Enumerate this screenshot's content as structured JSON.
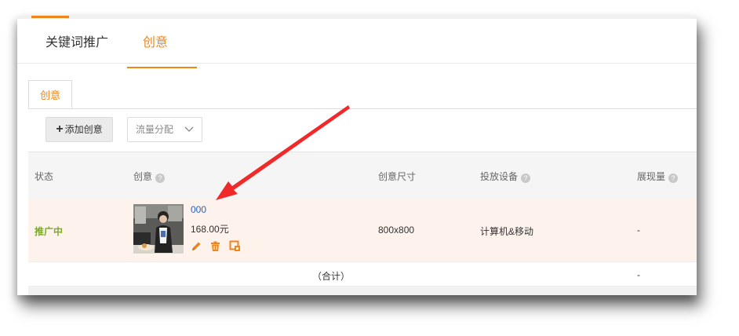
{
  "main_tabs": [
    {
      "label": "关键词推广"
    },
    {
      "label": "创意"
    }
  ],
  "sub_tab": {
    "label": "创意"
  },
  "toolbar": {
    "add_label": "添加创意",
    "flow_select": "流量分配"
  },
  "table": {
    "headers": {
      "status": "状态",
      "creative": "创意",
      "size": "创意尺寸",
      "device": "投放设备",
      "impressions": "展现量"
    },
    "row": {
      "status": "推广中",
      "name": "000",
      "price": "168.00元",
      "size": "800x800",
      "device": "计算机&移动",
      "impressions": "-"
    },
    "total": {
      "label": "（合计）",
      "impressions": "-"
    }
  },
  "icons": {
    "help": "question-circle-icon",
    "edit": "pencil-icon",
    "delete": "trash-icon",
    "preview": "preview-icon"
  },
  "colors": {
    "accent": "#f0861a",
    "status": "#7bab22",
    "link": "#2a5fbd",
    "annotation": "#f02a2a"
  }
}
